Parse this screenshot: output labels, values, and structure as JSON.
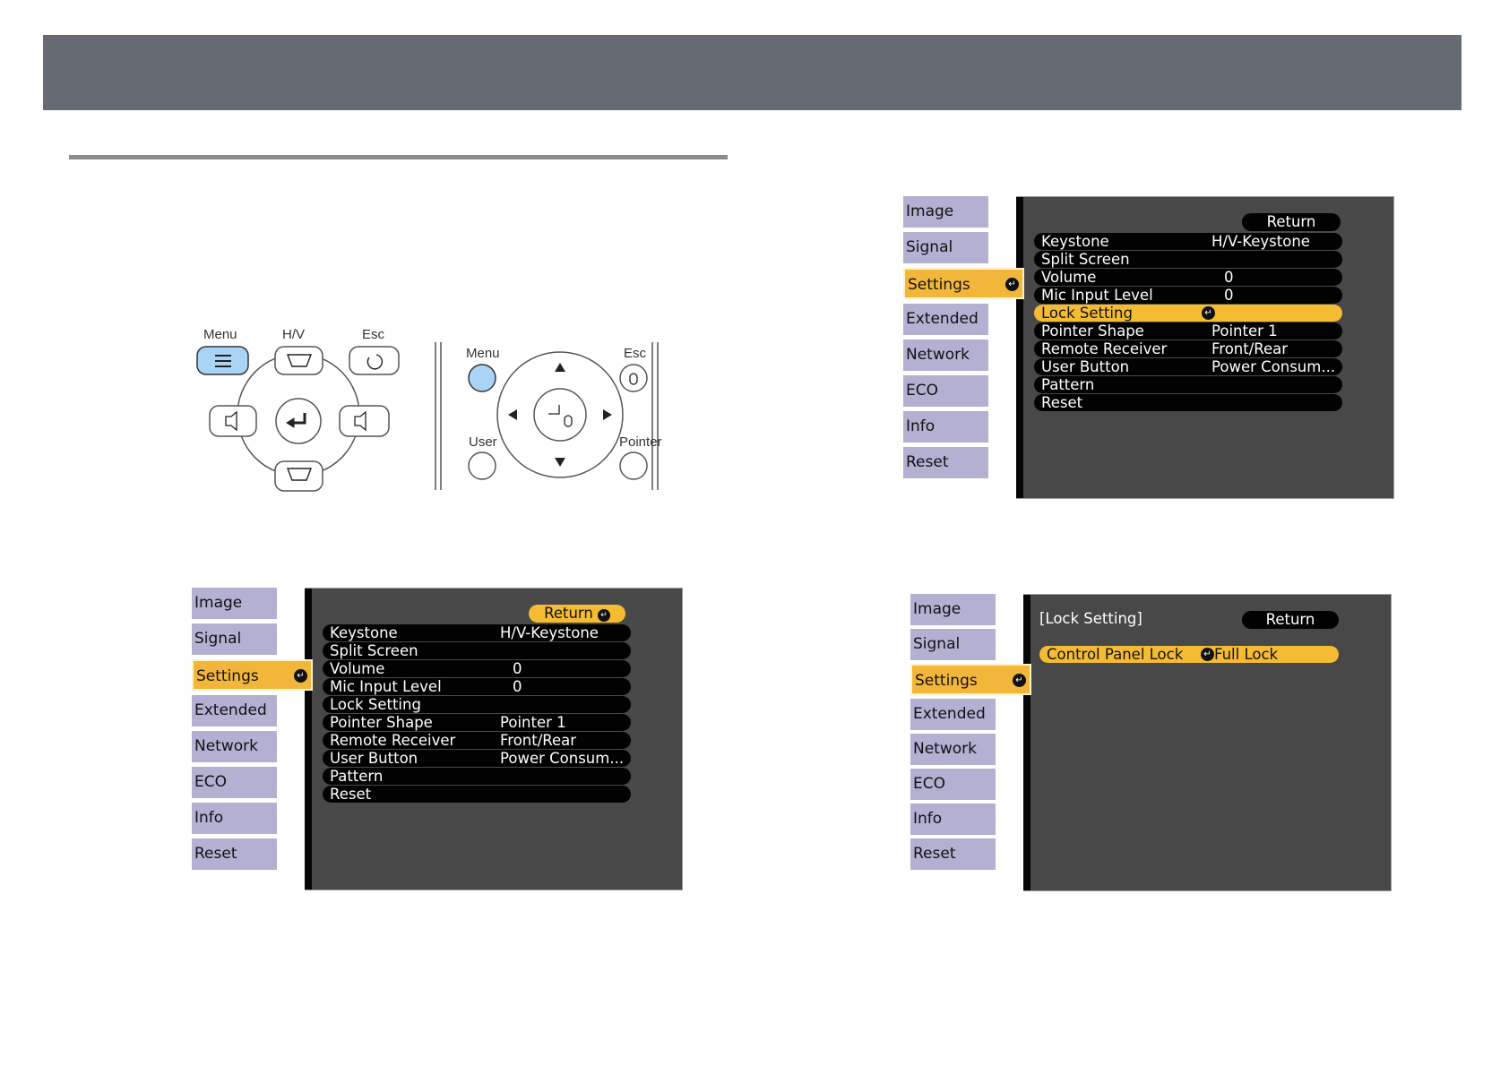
{
  "buttons_figure": {
    "control_panel": {
      "menu_label": "Menu",
      "hv_label": "H/V",
      "esc_label": "Esc"
    },
    "remote": {
      "menu_label": "Menu",
      "esc_label": "Esc",
      "user_label": "User",
      "pointer_label": "Pointer"
    }
  },
  "menu_tabs": [
    "Image",
    "Signal",
    "Settings",
    "Extended",
    "Network",
    "ECO",
    "Info",
    "Reset"
  ],
  "settings_items": [
    {
      "label": "Keystone",
      "value": "H/V-Keystone"
    },
    {
      "label": "Split Screen",
      "value": ""
    },
    {
      "label": "Volume",
      "value": "0"
    },
    {
      "label": "Mic Input Level",
      "value": "0"
    },
    {
      "label": "Lock Setting",
      "value": ""
    },
    {
      "label": "Pointer Shape",
      "value": "Pointer 1"
    },
    {
      "label": "Remote Receiver",
      "value": "Front/Rear"
    },
    {
      "label": "User Button",
      "value": "Power Consum..."
    },
    {
      "label": "Pattern",
      "value": ""
    },
    {
      "label": "Reset",
      "value": ""
    }
  ],
  "return_label": "Return",
  "enter_glyph": "↵",
  "lock_submenu": {
    "heading": "[Lock Setting]",
    "item_label": "Control Panel Lock",
    "item_value": "Full Lock"
  },
  "colors": {
    "header": "#666a73",
    "tab": "#b3b0d2",
    "active": "#f2b73a",
    "panel": "#484848",
    "button_highlight": "#a9d4f5"
  }
}
